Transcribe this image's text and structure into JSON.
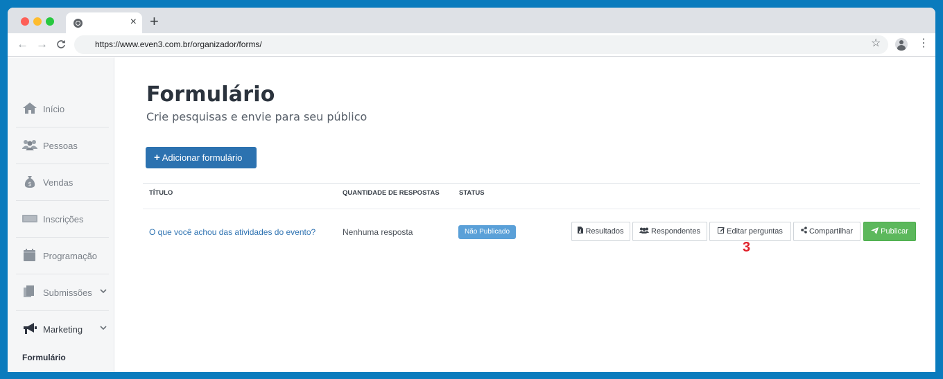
{
  "browser": {
    "tab": {
      "close_label": "×"
    },
    "new_tab_label": "+",
    "url": "https://www.even3.com.br/organizador/forms/",
    "nav": {
      "back": "←",
      "forward": "→",
      "reload": "C"
    },
    "star": "☆",
    "menu": "⋮"
  },
  "sidebar": {
    "items": [
      {
        "label": "Início",
        "icon": "home-icon"
      },
      {
        "label": "Pessoas",
        "icon": "people-icon"
      },
      {
        "label": "Vendas",
        "icon": "money-bag-icon"
      },
      {
        "label": "Inscrições",
        "icon": "ticket-icon"
      },
      {
        "label": "Programação",
        "icon": "calendar-icon"
      },
      {
        "label": "Submissões",
        "icon": "documents-icon",
        "chevron": "⌵"
      },
      {
        "label": "Marketing",
        "icon": "megaphone-icon",
        "chevron": "⌵"
      }
    ],
    "sub_active": "Formulário"
  },
  "main": {
    "title": "Formulário",
    "subtitle": "Crie pesquisas e envie para seu público",
    "add_button": {
      "plus": "+",
      "label": "Adicionar formulário"
    },
    "table": {
      "headers": {
        "title": "TÍTULO",
        "responses": "QUANTIDADE DE RESPOSTAS",
        "status": "STATUS"
      },
      "rows": [
        {
          "title": "O que você achou das atividades do evento?",
          "responses": "Nenhuma resposta",
          "status": "Não Publicado",
          "actions": {
            "results": "Resultados",
            "respondents": "Respondentes",
            "edit": "Editar perguntas",
            "share": "Compartilhar",
            "publish": "Publicar"
          }
        }
      ]
    },
    "step_marker": "3"
  },
  "colors": {
    "accent": "#2c72b0",
    "link": "#2f73b2",
    "badge": "#5aa0d8",
    "publish": "#5cb85c",
    "marker": "#e0202a",
    "frame": "#0a7bbd"
  }
}
